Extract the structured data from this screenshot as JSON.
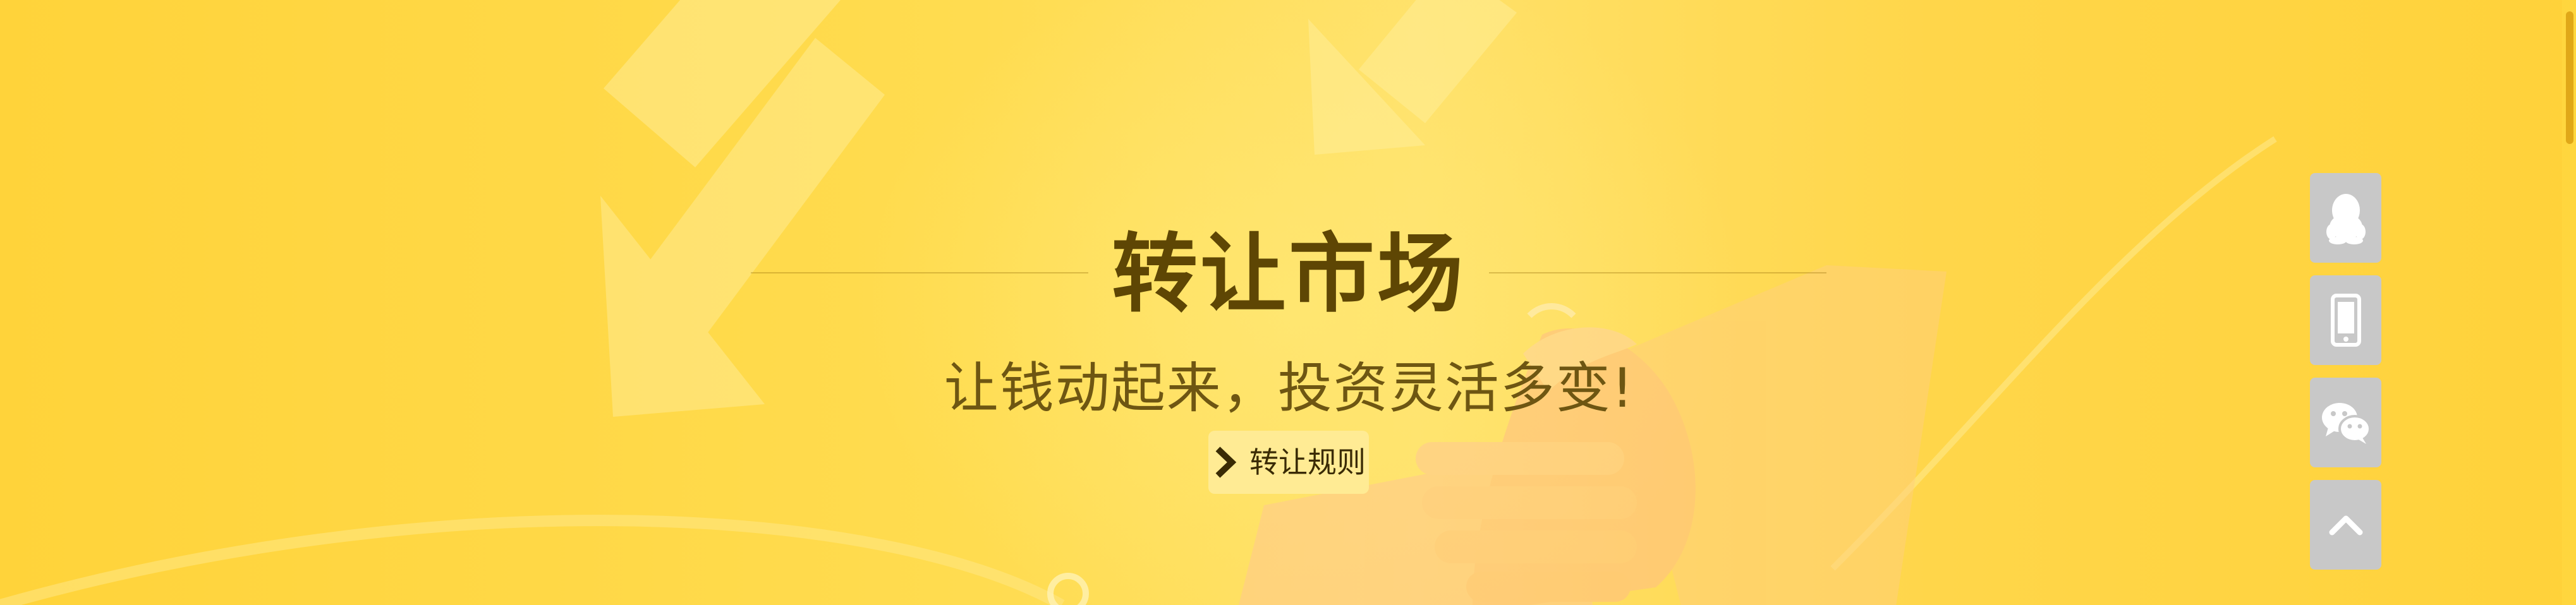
{
  "banner": {
    "title": "转让市场",
    "subtitle": "让钱动起来，投资灵活多变!",
    "rules_button_label": "转让规则"
  },
  "side_tools": [
    {
      "name": "qq",
      "icon": "qq-icon"
    },
    {
      "name": "mobile",
      "icon": "mobile-phone-icon"
    },
    {
      "name": "wechat",
      "icon": "wechat-icon"
    },
    {
      "name": "back-to-top",
      "icon": "chevron-up-icon"
    }
  ],
  "colors": {
    "banner_background": "#ffd43b",
    "title_text": "#5e4604",
    "button_background": "#ffeb94",
    "side_button_background": "#c8c8c8"
  }
}
